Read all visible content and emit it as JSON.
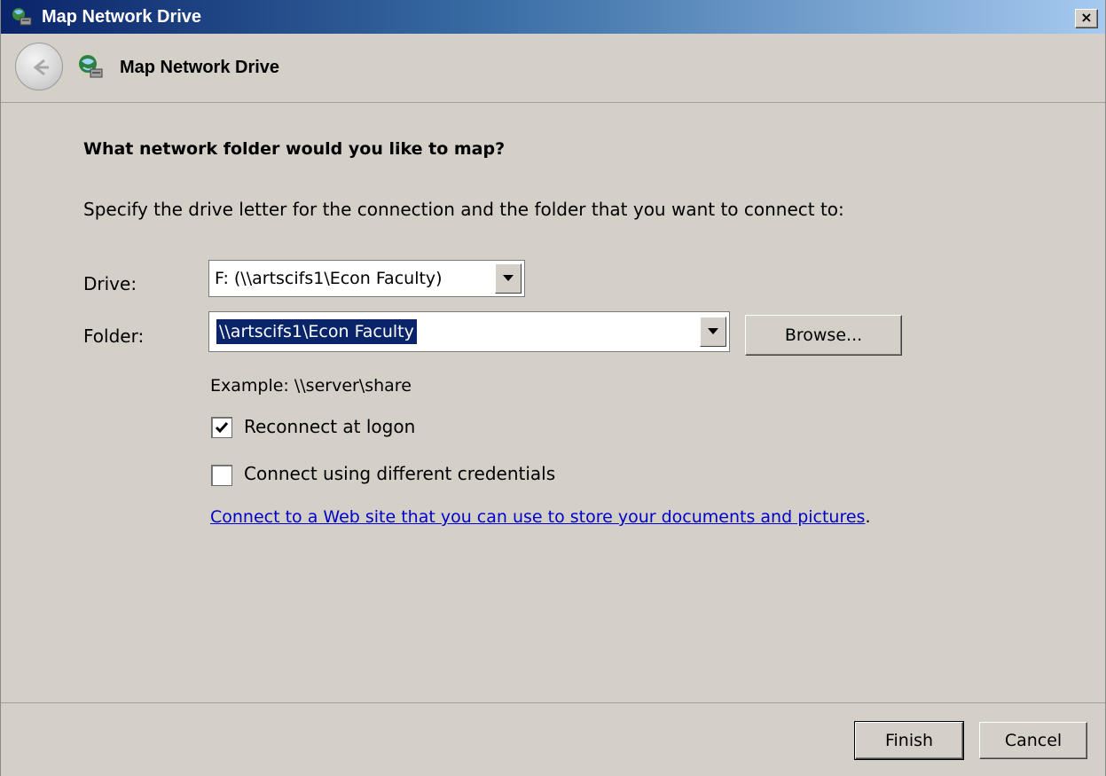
{
  "window": {
    "title": "Map Network Drive",
    "close_label": "×",
    "title_bar_color": "#0a246a"
  },
  "header": {
    "back_icon": "back-arrow-icon",
    "icon": "network-drive-icon",
    "title": "Map Network Drive"
  },
  "content": {
    "heading": "What network folder would you like to map?",
    "instructions": "Specify the drive letter for the connection and the folder that you want to connect to:",
    "drive": {
      "label": "Drive:",
      "value": "F: (\\\\artscifs1\\Econ Faculty)"
    },
    "folder": {
      "label": "Folder:",
      "value": "\\\\artscifs1\\Econ Faculty",
      "browse_label": "Browse..."
    },
    "example": "Example: \\\\server\\share",
    "reconnect": {
      "label": "Reconnect at logon",
      "checked": true
    },
    "credentials": {
      "label": "Connect using different credentials",
      "checked": false
    },
    "web_link": {
      "text": "Connect to a Web site that you can use to store your documents and pictures",
      "suffix": ".",
      "color": "#0000cc"
    }
  },
  "footer": {
    "finish_label": "Finish",
    "cancel_label": "Cancel"
  }
}
